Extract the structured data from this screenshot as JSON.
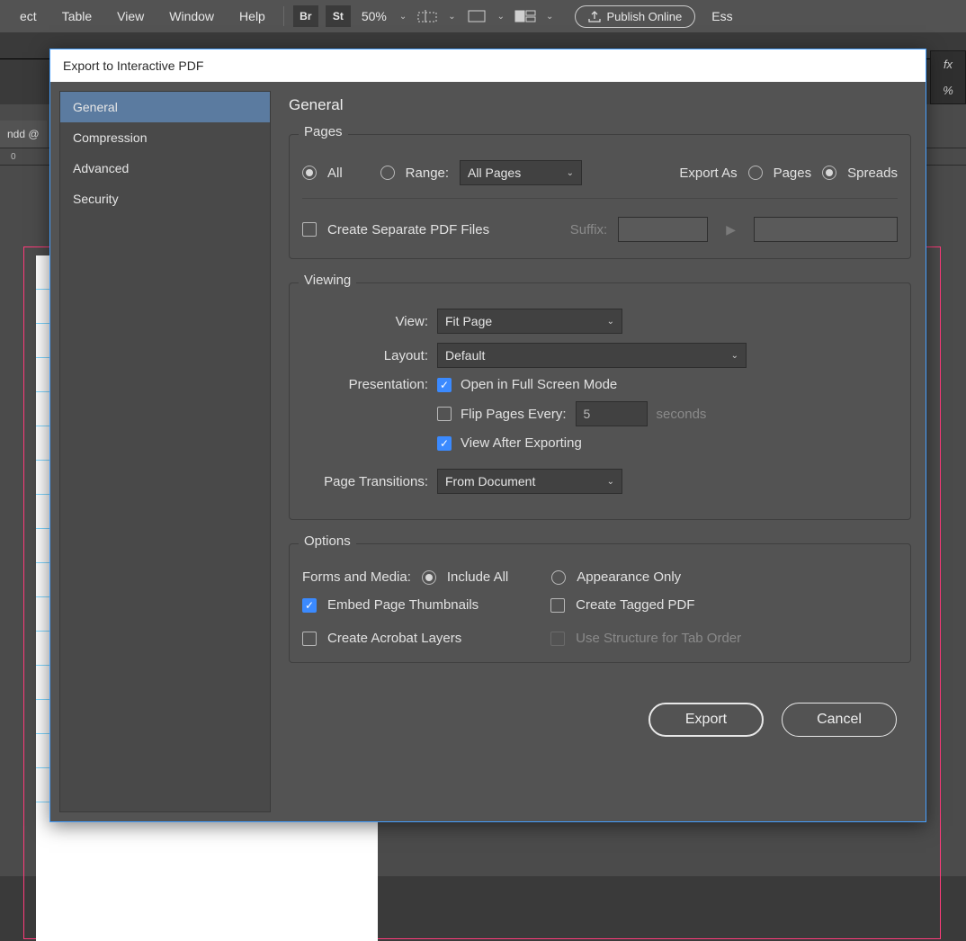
{
  "menubar": {
    "items": [
      "ect",
      "Table",
      "View",
      "Window",
      "Help"
    ],
    "br": "Br",
    "st": "St",
    "zoom": "50%",
    "publish": "Publish Online",
    "ess": "Ess"
  },
  "doc_tab": "ndd @",
  "ruler_zero": "0",
  "right_panel": {
    "fx": "fx",
    "pct": "%"
  },
  "dialog": {
    "title": "Export to Interactive PDF",
    "sidebar": [
      "General",
      "Compression",
      "Advanced",
      "Security"
    ],
    "active_index": 0,
    "content_title": "General",
    "pages": {
      "legend": "Pages",
      "all": "All",
      "range": "Range:",
      "range_value": "All Pages",
      "export_as": "Export As",
      "pages_label": "Pages",
      "spreads": "Spreads",
      "create_separate": "Create Separate PDF Files",
      "suffix": "Suffix:"
    },
    "viewing": {
      "legend": "Viewing",
      "view": "View:",
      "view_value": "Fit Page",
      "layout": "Layout:",
      "layout_value": "Default",
      "presentation": "Presentation:",
      "full_screen": "Open in Full Screen Mode",
      "flip": "Flip Pages Every:",
      "flip_value": "5",
      "seconds": "seconds",
      "view_after": "View After Exporting",
      "transitions": "Page Transitions:",
      "transitions_value": "From Document"
    },
    "options": {
      "legend": "Options",
      "forms": "Forms and Media:",
      "include_all": "Include All",
      "appearance": "Appearance Only",
      "embed_thumbs": "Embed Page Thumbnails",
      "tagged_pdf": "Create Tagged PDF",
      "acrobat_layers": "Create Acrobat Layers",
      "tab_order": "Use Structure for Tab Order"
    },
    "buttons": {
      "export": "Export",
      "cancel": "Cancel"
    }
  }
}
